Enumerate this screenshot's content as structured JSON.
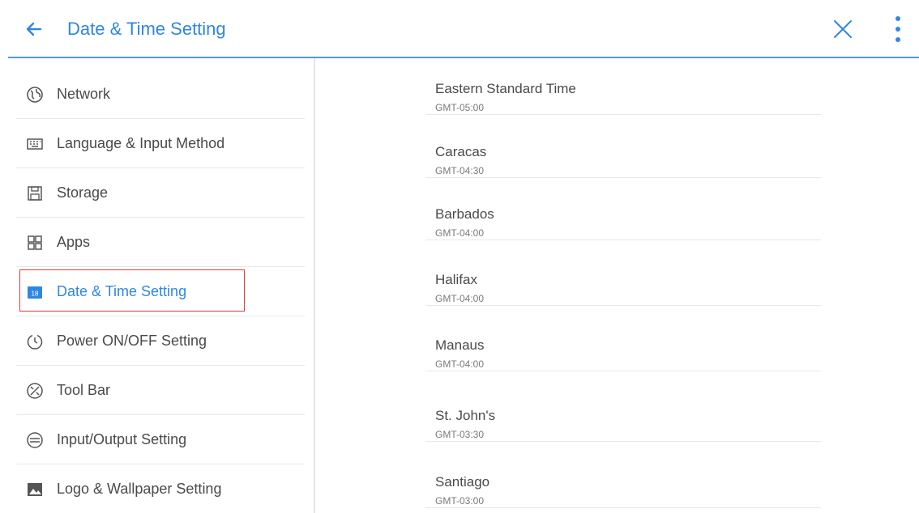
{
  "header": {
    "title": "Date & Time Setting",
    "accent_color": "#2f87df"
  },
  "sidebar": {
    "items": [
      {
        "label": "Network",
        "icon": "globe-icon",
        "selected": false
      },
      {
        "label": "Language & Input Method",
        "icon": "keyboard-icon",
        "selected": false
      },
      {
        "label": "Storage",
        "icon": "storage-icon",
        "selected": false
      },
      {
        "label": "Apps",
        "icon": "apps-grid-icon",
        "selected": false
      },
      {
        "label": "Date & Time Setting",
        "icon": "calendar-icon",
        "selected": true,
        "icon_text": "18"
      },
      {
        "label": "Power ON/OFF Setting",
        "icon": "power-timer-icon",
        "selected": false
      },
      {
        "label": "Tool Bar",
        "icon": "tool-icon",
        "selected": false
      },
      {
        "label": "Input/Output Setting",
        "icon": "input-output-icon",
        "selected": false
      },
      {
        "label": "Logo & Wallpaper Setting",
        "icon": "image-icon",
        "selected": false
      }
    ],
    "highlight_color": "#e03a3a"
  },
  "timezones": [
    {
      "name": "Eastern Standard Time",
      "offset": "GMT-05:00"
    },
    {
      "name": "Caracas",
      "offset": "GMT-04:30"
    },
    {
      "name": "Barbados",
      "offset": "GMT-04:00"
    },
    {
      "name": "Halifax",
      "offset": "GMT-04:00"
    },
    {
      "name": "Manaus",
      "offset": "GMT-04:00"
    },
    {
      "name": "St. John's",
      "offset": "GMT-03:30"
    },
    {
      "name": "Santiago",
      "offset": "GMT-03:00"
    }
  ]
}
